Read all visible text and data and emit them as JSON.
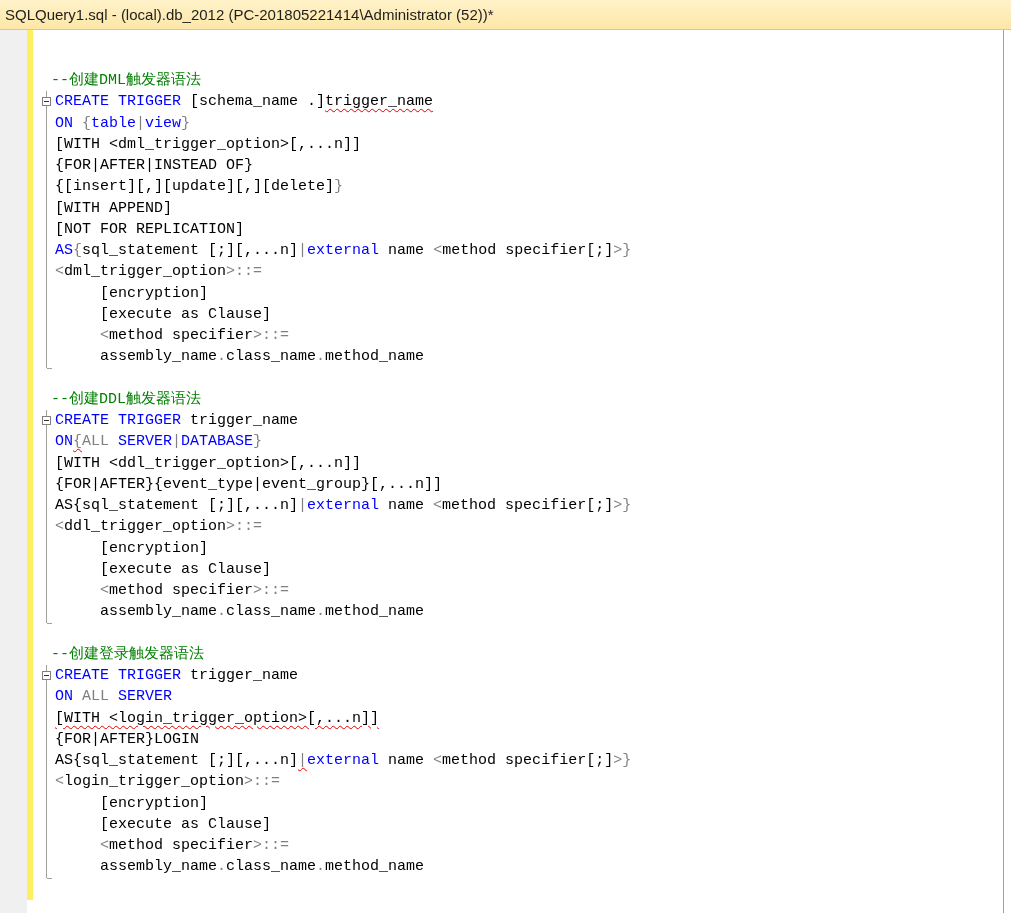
{
  "tab": {
    "title": "SQLQuery1.sql - (local).db_2012 (PC-201805221414\\Administrator (52))*"
  },
  "sections": [
    {
      "comment": "--创建DML触发器语法",
      "expanded": true,
      "lines": [
        {
          "indented": false,
          "tokens": [
            {
              "text": "CREATE TRIGGER",
              "kind": "keyword"
            },
            {
              "text": " [schema_name .]",
              "kind": "plain"
            },
            {
              "text": "trigger_name",
              "kind": "plain",
              "error": true
            }
          ]
        },
        {
          "indented": false,
          "tokens": [
            {
              "text": "ON",
              "kind": "keyword"
            },
            {
              "text": " {",
              "kind": "operator"
            },
            {
              "text": "table",
              "kind": "keyword"
            },
            {
              "text": "|",
              "kind": "operator"
            },
            {
              "text": "view",
              "kind": "keyword"
            },
            {
              "text": "}",
              "kind": "operator"
            }
          ]
        },
        {
          "indented": false,
          "tokens": [
            {
              "text": "[WITH <dml_trigger_option>[,...n]]",
              "kind": "plain"
            }
          ]
        },
        {
          "indented": false,
          "tokens": [
            {
              "text": "{FOR|AFTER|INSTEAD OF}",
              "kind": "plain"
            }
          ]
        },
        {
          "indented": false,
          "tokens": [
            {
              "text": "{[insert][,][update][,][delete]",
              "kind": "plain"
            },
            {
              "text": "}",
              "kind": "operator"
            }
          ]
        },
        {
          "indented": false,
          "tokens": [
            {
              "text": "[WITH APPEND]",
              "kind": "plain"
            }
          ]
        },
        {
          "indented": false,
          "tokens": [
            {
              "text": "[NOT FOR REPLICATION]",
              "kind": "plain"
            }
          ]
        },
        {
          "indented": false,
          "tokens": [
            {
              "text": "AS",
              "kind": "keyword"
            },
            {
              "text": "{",
              "kind": "operator"
            },
            {
              "text": "sql_statement [;][,...n]",
              "kind": "plain"
            },
            {
              "text": "|",
              "kind": "operator"
            },
            {
              "text": "external",
              "kind": "keyword"
            },
            {
              "text": " name ",
              "kind": "plain"
            },
            {
              "text": "<",
              "kind": "operator"
            },
            {
              "text": "method specifier[;]",
              "kind": "plain"
            },
            {
              "text": ">}",
              "kind": "operator"
            }
          ]
        },
        {
          "indented": false,
          "tokens": [
            {
              "text": "<",
              "kind": "operator"
            },
            {
              "text": "dml_trigger_option",
              "kind": "plain"
            },
            {
              "text": ">::=",
              "kind": "operator"
            }
          ]
        },
        {
          "indented": true,
          "tokens": [
            {
              "text": "[encryption]",
              "kind": "plain"
            }
          ]
        },
        {
          "indented": true,
          "tokens": [
            {
              "text": "[execute as Clause]",
              "kind": "plain"
            }
          ]
        },
        {
          "indented": true,
          "tokens": [
            {
              "text": "<",
              "kind": "operator"
            },
            {
              "text": "method specifier",
              "kind": "plain"
            },
            {
              "text": ">::=",
              "kind": "operator"
            }
          ]
        },
        {
          "indented": true,
          "tokens": [
            {
              "text": "assembly_name",
              "kind": "plain"
            },
            {
              "text": ".",
              "kind": "operator"
            },
            {
              "text": "class_name",
              "kind": "plain"
            },
            {
              "text": ".",
              "kind": "operator"
            },
            {
              "text": "method_name",
              "kind": "plain"
            }
          ]
        }
      ]
    },
    {
      "comment": "--创建DDL触发器语法",
      "expanded": true,
      "lines": [
        {
          "indented": false,
          "tokens": [
            {
              "text": "CREATE TRIGGER",
              "kind": "keyword"
            },
            {
              "text": " trigger_name",
              "kind": "plain"
            }
          ]
        },
        {
          "indented": false,
          "tokens": [
            {
              "text": "ON",
              "kind": "keyword"
            },
            {
              "text": "{",
              "kind": "operator",
              "error": true
            },
            {
              "text": "ALL ",
              "kind": "operator"
            },
            {
              "text": "SERVER",
              "kind": "keyword"
            },
            {
              "text": "|",
              "kind": "operator"
            },
            {
              "text": "DATABASE",
              "kind": "keyword"
            },
            {
              "text": "}",
              "kind": "operator"
            }
          ]
        },
        {
          "indented": false,
          "tokens": [
            {
              "text": "[WITH <ddl_trigger_option>[,...n]]",
              "kind": "plain"
            }
          ]
        },
        {
          "indented": false,
          "tokens": [
            {
              "text": "{FOR|AFTER}{event_type|event_group}[,...n]]",
              "kind": "plain"
            }
          ]
        },
        {
          "indented": false,
          "tokens": [
            {
              "text": "AS{sql_statement [;][,...n]",
              "kind": "plain"
            },
            {
              "text": "|",
              "kind": "operator"
            },
            {
              "text": "external",
              "kind": "keyword"
            },
            {
              "text": " name ",
              "kind": "plain"
            },
            {
              "text": "<",
              "kind": "operator"
            },
            {
              "text": "method specifier[;]",
              "kind": "plain"
            },
            {
              "text": ">}",
              "kind": "operator"
            }
          ]
        },
        {
          "indented": false,
          "tokens": [
            {
              "text": "<",
              "kind": "operator"
            },
            {
              "text": "ddl_trigger_option",
              "kind": "plain"
            },
            {
              "text": ">::=",
              "kind": "operator"
            }
          ]
        },
        {
          "indented": true,
          "tokens": [
            {
              "text": "[encryption]",
              "kind": "plain"
            }
          ]
        },
        {
          "indented": true,
          "tokens": [
            {
              "text": "[execute as Clause]",
              "kind": "plain"
            }
          ]
        },
        {
          "indented": true,
          "tokens": [
            {
              "text": "<",
              "kind": "operator"
            },
            {
              "text": "method specifier",
              "kind": "plain"
            },
            {
              "text": ">::=",
              "kind": "operator"
            }
          ]
        },
        {
          "indented": true,
          "tokens": [
            {
              "text": "assembly_name",
              "kind": "plain"
            },
            {
              "text": ".",
              "kind": "operator"
            },
            {
              "text": "class_name",
              "kind": "plain"
            },
            {
              "text": ".",
              "kind": "operator"
            },
            {
              "text": "method_name",
              "kind": "plain"
            }
          ]
        }
      ]
    },
    {
      "comment": "--创建登录触发器语法",
      "expanded": true,
      "lines": [
        {
          "indented": false,
          "tokens": [
            {
              "text": "CREATE TRIGGER",
              "kind": "keyword"
            },
            {
              "text": " trigger_name",
              "kind": "plain"
            }
          ]
        },
        {
          "indented": false,
          "tokens": [
            {
              "text": "ON",
              "kind": "keyword"
            },
            {
              "text": " ALL ",
              "kind": "operator"
            },
            {
              "text": "SERVER",
              "kind": "keyword"
            }
          ]
        },
        {
          "indented": false,
          "tokens": [
            {
              "text": "[WITH <login_trigger_option>[,...n]]",
              "kind": "plain",
              "error": true
            }
          ]
        },
        {
          "indented": false,
          "tokens": [
            {
              "text": "{FOR|AFTER}LOGIN",
              "kind": "plain"
            }
          ]
        },
        {
          "indented": false,
          "tokens": [
            {
              "text": "AS{sql_statement [;][,...n]",
              "kind": "plain"
            },
            {
              "text": "|",
              "kind": "operator",
              "error": true
            },
            {
              "text": "external",
              "kind": "keyword"
            },
            {
              "text": " name ",
              "kind": "plain"
            },
            {
              "text": "<",
              "kind": "operator"
            },
            {
              "text": "method specifier[;]",
              "kind": "plain"
            },
            {
              "text": ">}",
              "kind": "operator"
            }
          ]
        },
        {
          "indented": false,
          "tokens": [
            {
              "text": "<",
              "kind": "operator"
            },
            {
              "text": "login_trigger_option",
              "kind": "plain"
            },
            {
              "text": ">::=",
              "kind": "operator"
            }
          ]
        },
        {
          "indented": true,
          "tokens": [
            {
              "text": "[encryption]",
              "kind": "plain"
            }
          ]
        },
        {
          "indented": true,
          "tokens": [
            {
              "text": "[execute as Clause]",
              "kind": "plain"
            }
          ]
        },
        {
          "indented": true,
          "tokens": [
            {
              "text": "<",
              "kind": "operator"
            },
            {
              "text": "method specifier",
              "kind": "plain"
            },
            {
              "text": ">::=",
              "kind": "operator"
            }
          ]
        },
        {
          "indented": true,
          "tokens": [
            {
              "text": "assembly_name",
              "kind": "plain"
            },
            {
              "text": ".",
              "kind": "operator"
            },
            {
              "text": "class_name",
              "kind": "plain"
            },
            {
              "text": ".",
              "kind": "operator"
            },
            {
              "text": "method_name",
              "kind": "plain"
            }
          ]
        }
      ]
    }
  ]
}
